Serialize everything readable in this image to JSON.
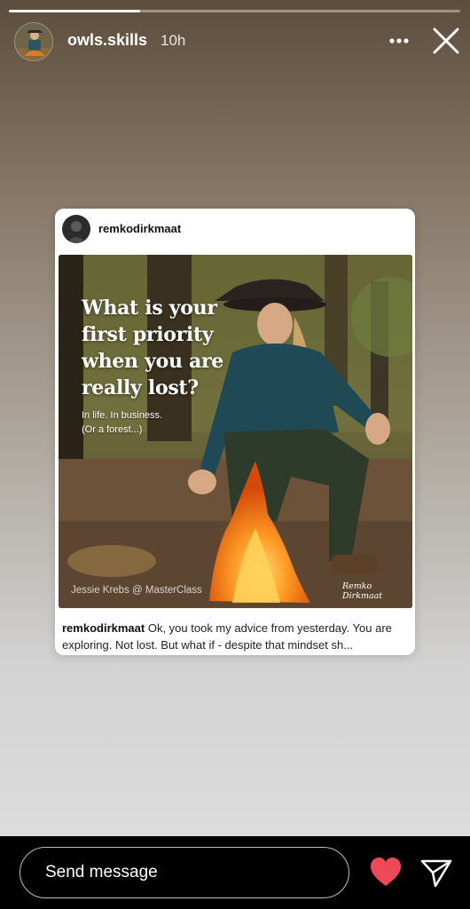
{
  "story": {
    "progress": 0.29,
    "username": "owls.skills",
    "time": "10h",
    "avatar_icon": "profile-photo-icon",
    "more_icon": "more-options-icon",
    "close_icon": "close-icon"
  },
  "post": {
    "author": "remkodirkmaat",
    "headline": "What is your first priority when you are really lost?",
    "subline_1": "In life. In business.",
    "subline_2": "(Or a forest...)",
    "credit": "Jessie Krebs @ MasterClass",
    "signature": "Remko Dirkmaat",
    "caption_user": "remkodirkmaat",
    "caption_text": "Ok, you took my advice from yesterday. You are exploring. Not lost. But what if - despite that mindset sh..."
  },
  "bottom": {
    "placeholder": "Send message",
    "like_icon": "heart-icon",
    "like_color": "#ed4956",
    "share_icon": "send-icon"
  }
}
